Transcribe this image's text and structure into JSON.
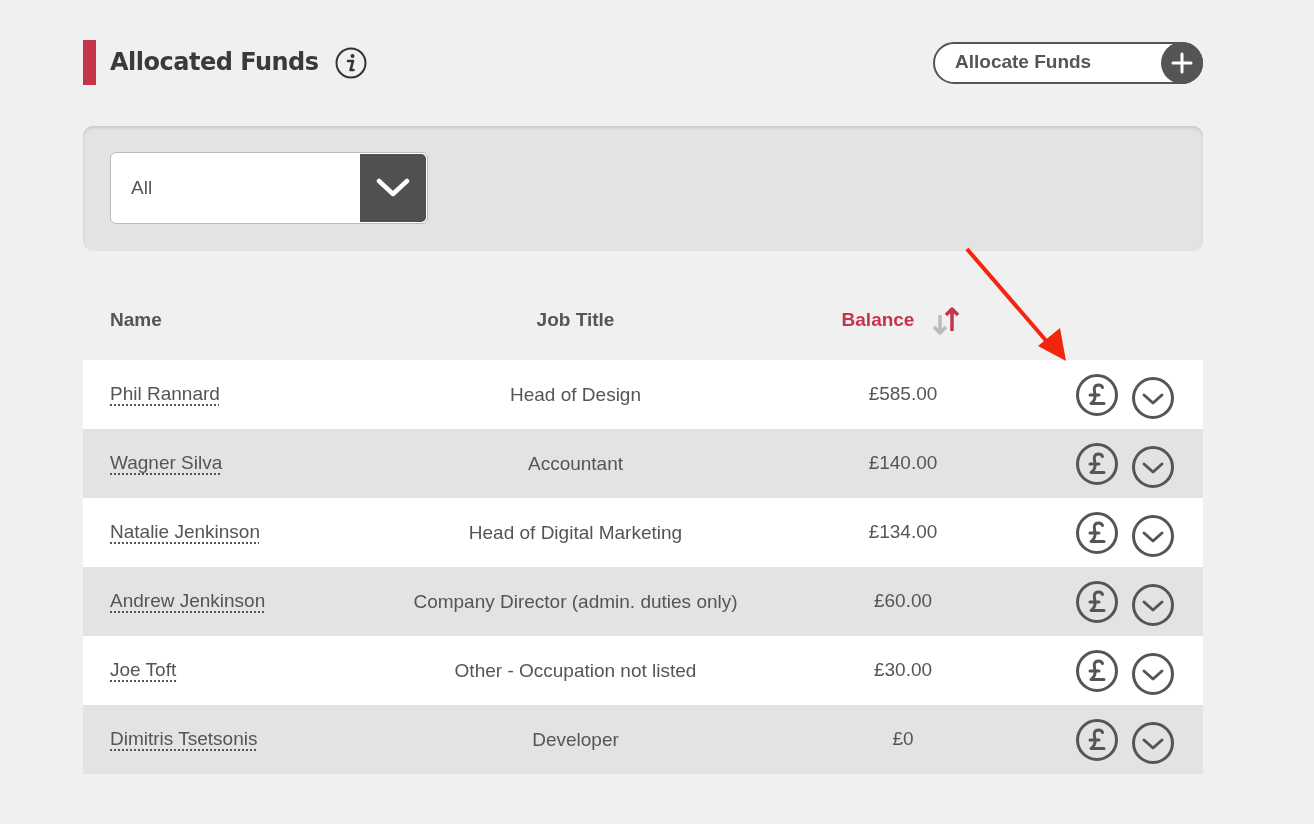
{
  "page": {
    "title": "Allocated Funds",
    "action_button": "Allocate Funds"
  },
  "filter": {
    "value": "All"
  },
  "table": {
    "columns": [
      {
        "label": "Name",
        "sorted": false
      },
      {
        "label": "Job Title",
        "sorted": false
      },
      {
        "label": "Balance",
        "sorted": true
      }
    ],
    "rows": [
      {
        "name": "Phil Rannard",
        "job_title": "Head of Design",
        "balance": "£585.00"
      },
      {
        "name": "Wagner Silva",
        "job_title": "Accountant",
        "balance": "£140.00"
      },
      {
        "name": "Natalie Jenkinson",
        "job_title": "Head of Digital Marketing",
        "balance": "£134.00"
      },
      {
        "name": "Andrew Jenkinson",
        "job_title": "Company Director (admin. duties only)",
        "balance": "£60.00"
      },
      {
        "name": "Joe Toft",
        "job_title": "Other - Occupation not listed",
        "balance": "£30.00"
      },
      {
        "name": "Dimitris Tsetsonis",
        "job_title": "Developer",
        "balance": "£0"
      }
    ]
  }
}
